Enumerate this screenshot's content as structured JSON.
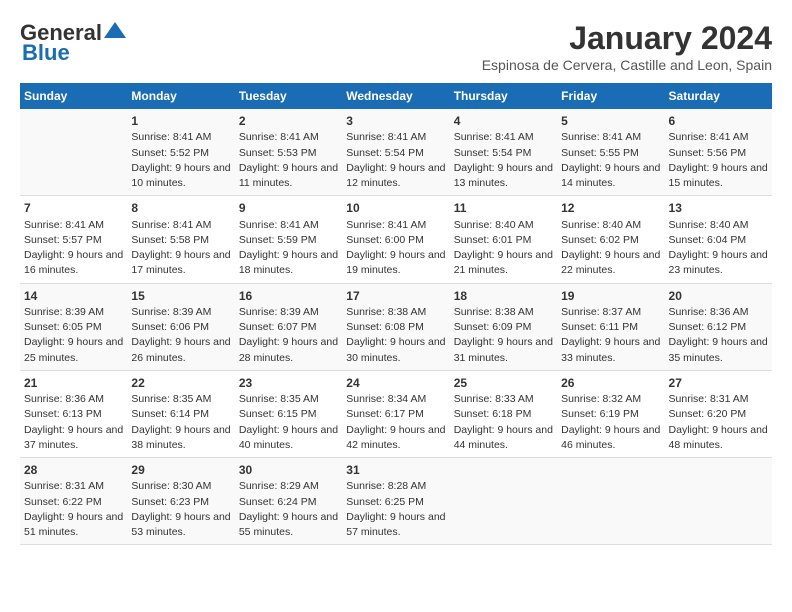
{
  "logo": {
    "line1": "General",
    "line2": "Blue"
  },
  "title": "January 2024",
  "subtitle": "Espinosa de Cervera, Castille and Leon, Spain",
  "columns": [
    "Sunday",
    "Monday",
    "Tuesday",
    "Wednesday",
    "Thursday",
    "Friday",
    "Saturday"
  ],
  "weeks": [
    [
      {
        "day": "",
        "sunrise": "",
        "sunset": "",
        "daylight": ""
      },
      {
        "day": "1",
        "sunrise": "Sunrise: 8:41 AM",
        "sunset": "Sunset: 5:52 PM",
        "daylight": "Daylight: 9 hours and 10 minutes."
      },
      {
        "day": "2",
        "sunrise": "Sunrise: 8:41 AM",
        "sunset": "Sunset: 5:53 PM",
        "daylight": "Daylight: 9 hours and 11 minutes."
      },
      {
        "day": "3",
        "sunrise": "Sunrise: 8:41 AM",
        "sunset": "Sunset: 5:54 PM",
        "daylight": "Daylight: 9 hours and 12 minutes."
      },
      {
        "day": "4",
        "sunrise": "Sunrise: 8:41 AM",
        "sunset": "Sunset: 5:54 PM",
        "daylight": "Daylight: 9 hours and 13 minutes."
      },
      {
        "day": "5",
        "sunrise": "Sunrise: 8:41 AM",
        "sunset": "Sunset: 5:55 PM",
        "daylight": "Daylight: 9 hours and 14 minutes."
      },
      {
        "day": "6",
        "sunrise": "Sunrise: 8:41 AM",
        "sunset": "Sunset: 5:56 PM",
        "daylight": "Daylight: 9 hours and 15 minutes."
      }
    ],
    [
      {
        "day": "7",
        "sunrise": "Sunrise: 8:41 AM",
        "sunset": "Sunset: 5:57 PM",
        "daylight": "Daylight: 9 hours and 16 minutes."
      },
      {
        "day": "8",
        "sunrise": "Sunrise: 8:41 AM",
        "sunset": "Sunset: 5:58 PM",
        "daylight": "Daylight: 9 hours and 17 minutes."
      },
      {
        "day": "9",
        "sunrise": "Sunrise: 8:41 AM",
        "sunset": "Sunset: 5:59 PM",
        "daylight": "Daylight: 9 hours and 18 minutes."
      },
      {
        "day": "10",
        "sunrise": "Sunrise: 8:41 AM",
        "sunset": "Sunset: 6:00 PM",
        "daylight": "Daylight: 9 hours and 19 minutes."
      },
      {
        "day": "11",
        "sunrise": "Sunrise: 8:40 AM",
        "sunset": "Sunset: 6:01 PM",
        "daylight": "Daylight: 9 hours and 21 minutes."
      },
      {
        "day": "12",
        "sunrise": "Sunrise: 8:40 AM",
        "sunset": "Sunset: 6:02 PM",
        "daylight": "Daylight: 9 hours and 22 minutes."
      },
      {
        "day": "13",
        "sunrise": "Sunrise: 8:40 AM",
        "sunset": "Sunset: 6:04 PM",
        "daylight": "Daylight: 9 hours and 23 minutes."
      }
    ],
    [
      {
        "day": "14",
        "sunrise": "Sunrise: 8:39 AM",
        "sunset": "Sunset: 6:05 PM",
        "daylight": "Daylight: 9 hours and 25 minutes."
      },
      {
        "day": "15",
        "sunrise": "Sunrise: 8:39 AM",
        "sunset": "Sunset: 6:06 PM",
        "daylight": "Daylight: 9 hours and 26 minutes."
      },
      {
        "day": "16",
        "sunrise": "Sunrise: 8:39 AM",
        "sunset": "Sunset: 6:07 PM",
        "daylight": "Daylight: 9 hours and 28 minutes."
      },
      {
        "day": "17",
        "sunrise": "Sunrise: 8:38 AM",
        "sunset": "Sunset: 6:08 PM",
        "daylight": "Daylight: 9 hours and 30 minutes."
      },
      {
        "day": "18",
        "sunrise": "Sunrise: 8:38 AM",
        "sunset": "Sunset: 6:09 PM",
        "daylight": "Daylight: 9 hours and 31 minutes."
      },
      {
        "day": "19",
        "sunrise": "Sunrise: 8:37 AM",
        "sunset": "Sunset: 6:11 PM",
        "daylight": "Daylight: 9 hours and 33 minutes."
      },
      {
        "day": "20",
        "sunrise": "Sunrise: 8:36 AM",
        "sunset": "Sunset: 6:12 PM",
        "daylight": "Daylight: 9 hours and 35 minutes."
      }
    ],
    [
      {
        "day": "21",
        "sunrise": "Sunrise: 8:36 AM",
        "sunset": "Sunset: 6:13 PM",
        "daylight": "Daylight: 9 hours and 37 minutes."
      },
      {
        "day": "22",
        "sunrise": "Sunrise: 8:35 AM",
        "sunset": "Sunset: 6:14 PM",
        "daylight": "Daylight: 9 hours and 38 minutes."
      },
      {
        "day": "23",
        "sunrise": "Sunrise: 8:35 AM",
        "sunset": "Sunset: 6:15 PM",
        "daylight": "Daylight: 9 hours and 40 minutes."
      },
      {
        "day": "24",
        "sunrise": "Sunrise: 8:34 AM",
        "sunset": "Sunset: 6:17 PM",
        "daylight": "Daylight: 9 hours and 42 minutes."
      },
      {
        "day": "25",
        "sunrise": "Sunrise: 8:33 AM",
        "sunset": "Sunset: 6:18 PM",
        "daylight": "Daylight: 9 hours and 44 minutes."
      },
      {
        "day": "26",
        "sunrise": "Sunrise: 8:32 AM",
        "sunset": "Sunset: 6:19 PM",
        "daylight": "Daylight: 9 hours and 46 minutes."
      },
      {
        "day": "27",
        "sunrise": "Sunrise: 8:31 AM",
        "sunset": "Sunset: 6:20 PM",
        "daylight": "Daylight: 9 hours and 48 minutes."
      }
    ],
    [
      {
        "day": "28",
        "sunrise": "Sunrise: 8:31 AM",
        "sunset": "Sunset: 6:22 PM",
        "daylight": "Daylight: 9 hours and 51 minutes."
      },
      {
        "day": "29",
        "sunrise": "Sunrise: 8:30 AM",
        "sunset": "Sunset: 6:23 PM",
        "daylight": "Daylight: 9 hours and 53 minutes."
      },
      {
        "day": "30",
        "sunrise": "Sunrise: 8:29 AM",
        "sunset": "Sunset: 6:24 PM",
        "daylight": "Daylight: 9 hours and 55 minutes."
      },
      {
        "day": "31",
        "sunrise": "Sunrise: 8:28 AM",
        "sunset": "Sunset: 6:25 PM",
        "daylight": "Daylight: 9 hours and 57 minutes."
      },
      {
        "day": "",
        "sunrise": "",
        "sunset": "",
        "daylight": ""
      },
      {
        "day": "",
        "sunrise": "",
        "sunset": "",
        "daylight": ""
      },
      {
        "day": "",
        "sunrise": "",
        "sunset": "",
        "daylight": ""
      }
    ]
  ]
}
